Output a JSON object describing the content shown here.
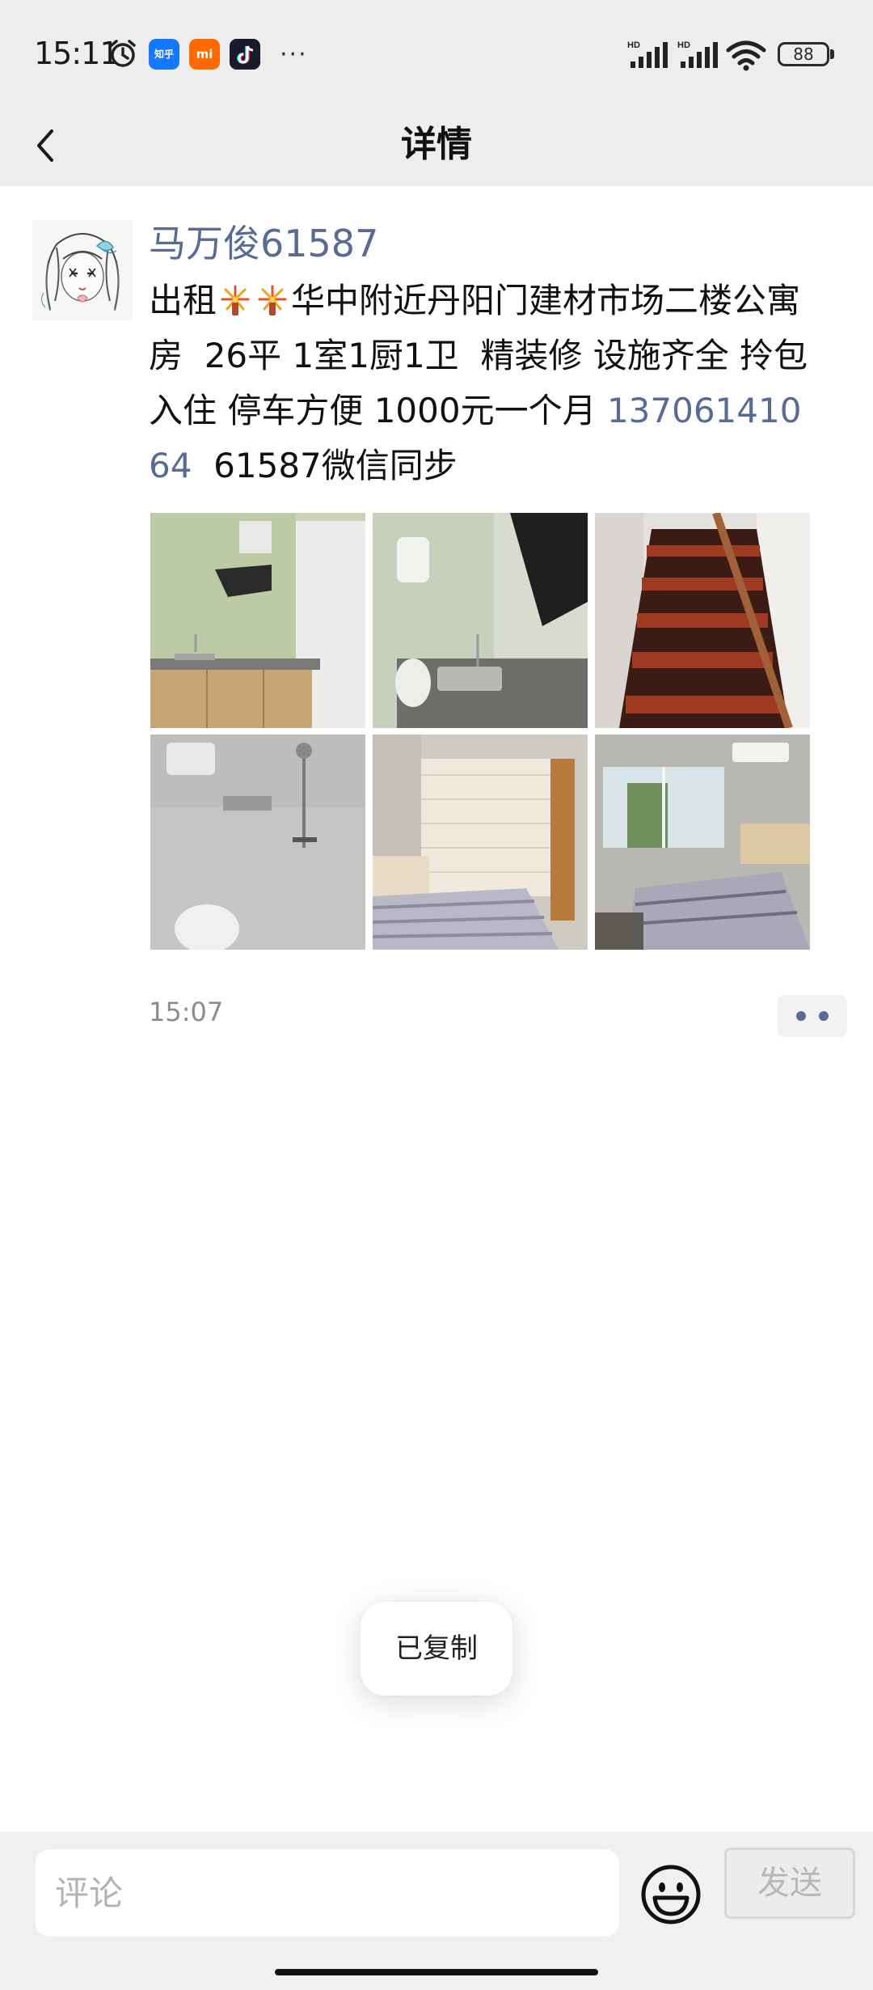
{
  "status_bar": {
    "time": "15:11",
    "notification_icons": [
      "alarm-icon",
      "zhihu-icon",
      "mi-icon",
      "tiktok-icon"
    ],
    "zhihu_label": "知乎",
    "mi_label": "mi",
    "more_glyph": "···",
    "signal_label": "HD",
    "battery_level": "88"
  },
  "header": {
    "title": "详情",
    "back_icon": "chevron-left-icon",
    "background": "#ededed"
  },
  "post": {
    "author": "马万俊61587",
    "text_parts": {
      "p1": "出租",
      "p2": "华中附近丹阳门建材市场二楼公寓房  26平 1室1厨1卫  精装修 设施齐全 拎包入住 停车方便 1000元一个月 ",
      "phone": "13706141064",
      "p3": "  61587微信同步"
    },
    "photo_count": 6,
    "time": "15:07",
    "link_color": "#576b95"
  },
  "toast": {
    "text": "已复制"
  },
  "comment_bar": {
    "placeholder": "评论",
    "emoji_icon": "smiley-icon",
    "send_label": "发送"
  }
}
